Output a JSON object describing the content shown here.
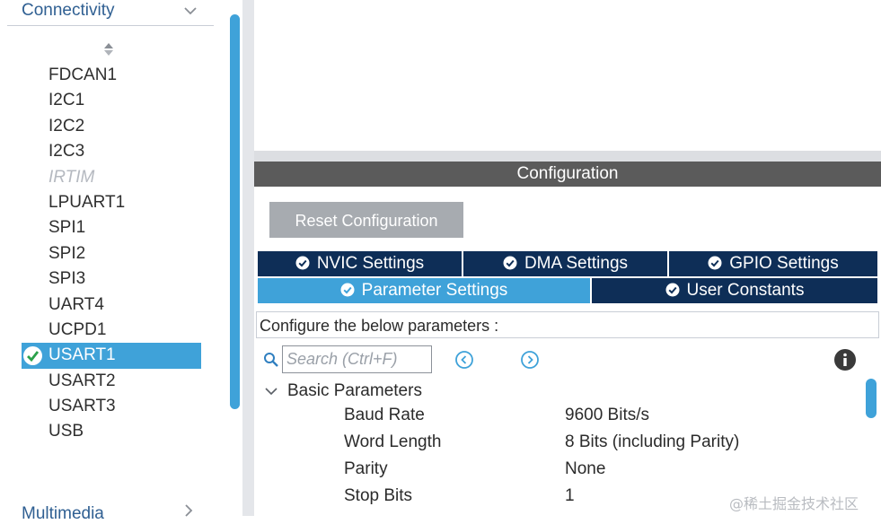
{
  "sidebar": {
    "category_title": "Connectivity",
    "peripherals": [
      {
        "label": "FDCAN1",
        "state": "normal"
      },
      {
        "label": "I2C1",
        "state": "normal"
      },
      {
        "label": "I2C2",
        "state": "normal"
      },
      {
        "label": "I2C3",
        "state": "normal"
      },
      {
        "label": "IRTIM",
        "state": "disabled"
      },
      {
        "label": "LPUART1",
        "state": "normal"
      },
      {
        "label": "SPI1",
        "state": "normal"
      },
      {
        "label": "SPI2",
        "state": "normal"
      },
      {
        "label": "SPI3",
        "state": "normal"
      },
      {
        "label": "UART4",
        "state": "normal"
      },
      {
        "label": "UCPD1",
        "state": "normal"
      },
      {
        "label": "USART1",
        "state": "selected"
      },
      {
        "label": "USART2",
        "state": "normal"
      },
      {
        "label": "USART3",
        "state": "normal"
      },
      {
        "label": "USB",
        "state": "normal"
      }
    ],
    "next_category_title": "Multimedia"
  },
  "configuration": {
    "header": "Configuration",
    "reset_label": "Reset Configuration",
    "tabs": {
      "nvic": "NVIC Settings",
      "dma": "DMA Settings",
      "gpio": "GPIO Settings",
      "param": "Parameter Settings",
      "user": "User Constants"
    },
    "active_tab": "Parameter Settings",
    "configure_label": "Configure the below parameters :",
    "search_placeholder": "Search (Ctrl+F)",
    "group_label": "Basic Parameters",
    "parameters": [
      {
        "name": "Baud Rate",
        "value": "9600 Bits/s"
      },
      {
        "name": "Word Length",
        "value": "8 Bits (including Parity)"
      },
      {
        "name": "Parity",
        "value": "None"
      },
      {
        "name": "Stop Bits",
        "value": "1"
      }
    ]
  },
  "watermark": "@稀土掘金技术社区",
  "colors": {
    "accent": "#3fa2d9",
    "tab_dark": "#0e2e57",
    "header_gray": "#5b5b5b",
    "button_gray": "#a7abb0",
    "category_text": "#2f5f92"
  },
  "icons": {
    "category_toggle": "chevron-down-icon",
    "next_category_toggle": "chevron-right-icon",
    "sort": "sort-icon",
    "selected_mark": "check-circle-icon",
    "tab_mark": "check-circle-icon",
    "search": "search-icon",
    "previous": "chevron-left-circle-icon",
    "next": "chevron-right-circle-icon",
    "info": "info-icon",
    "group_toggle": "chevron-down-icon"
  }
}
